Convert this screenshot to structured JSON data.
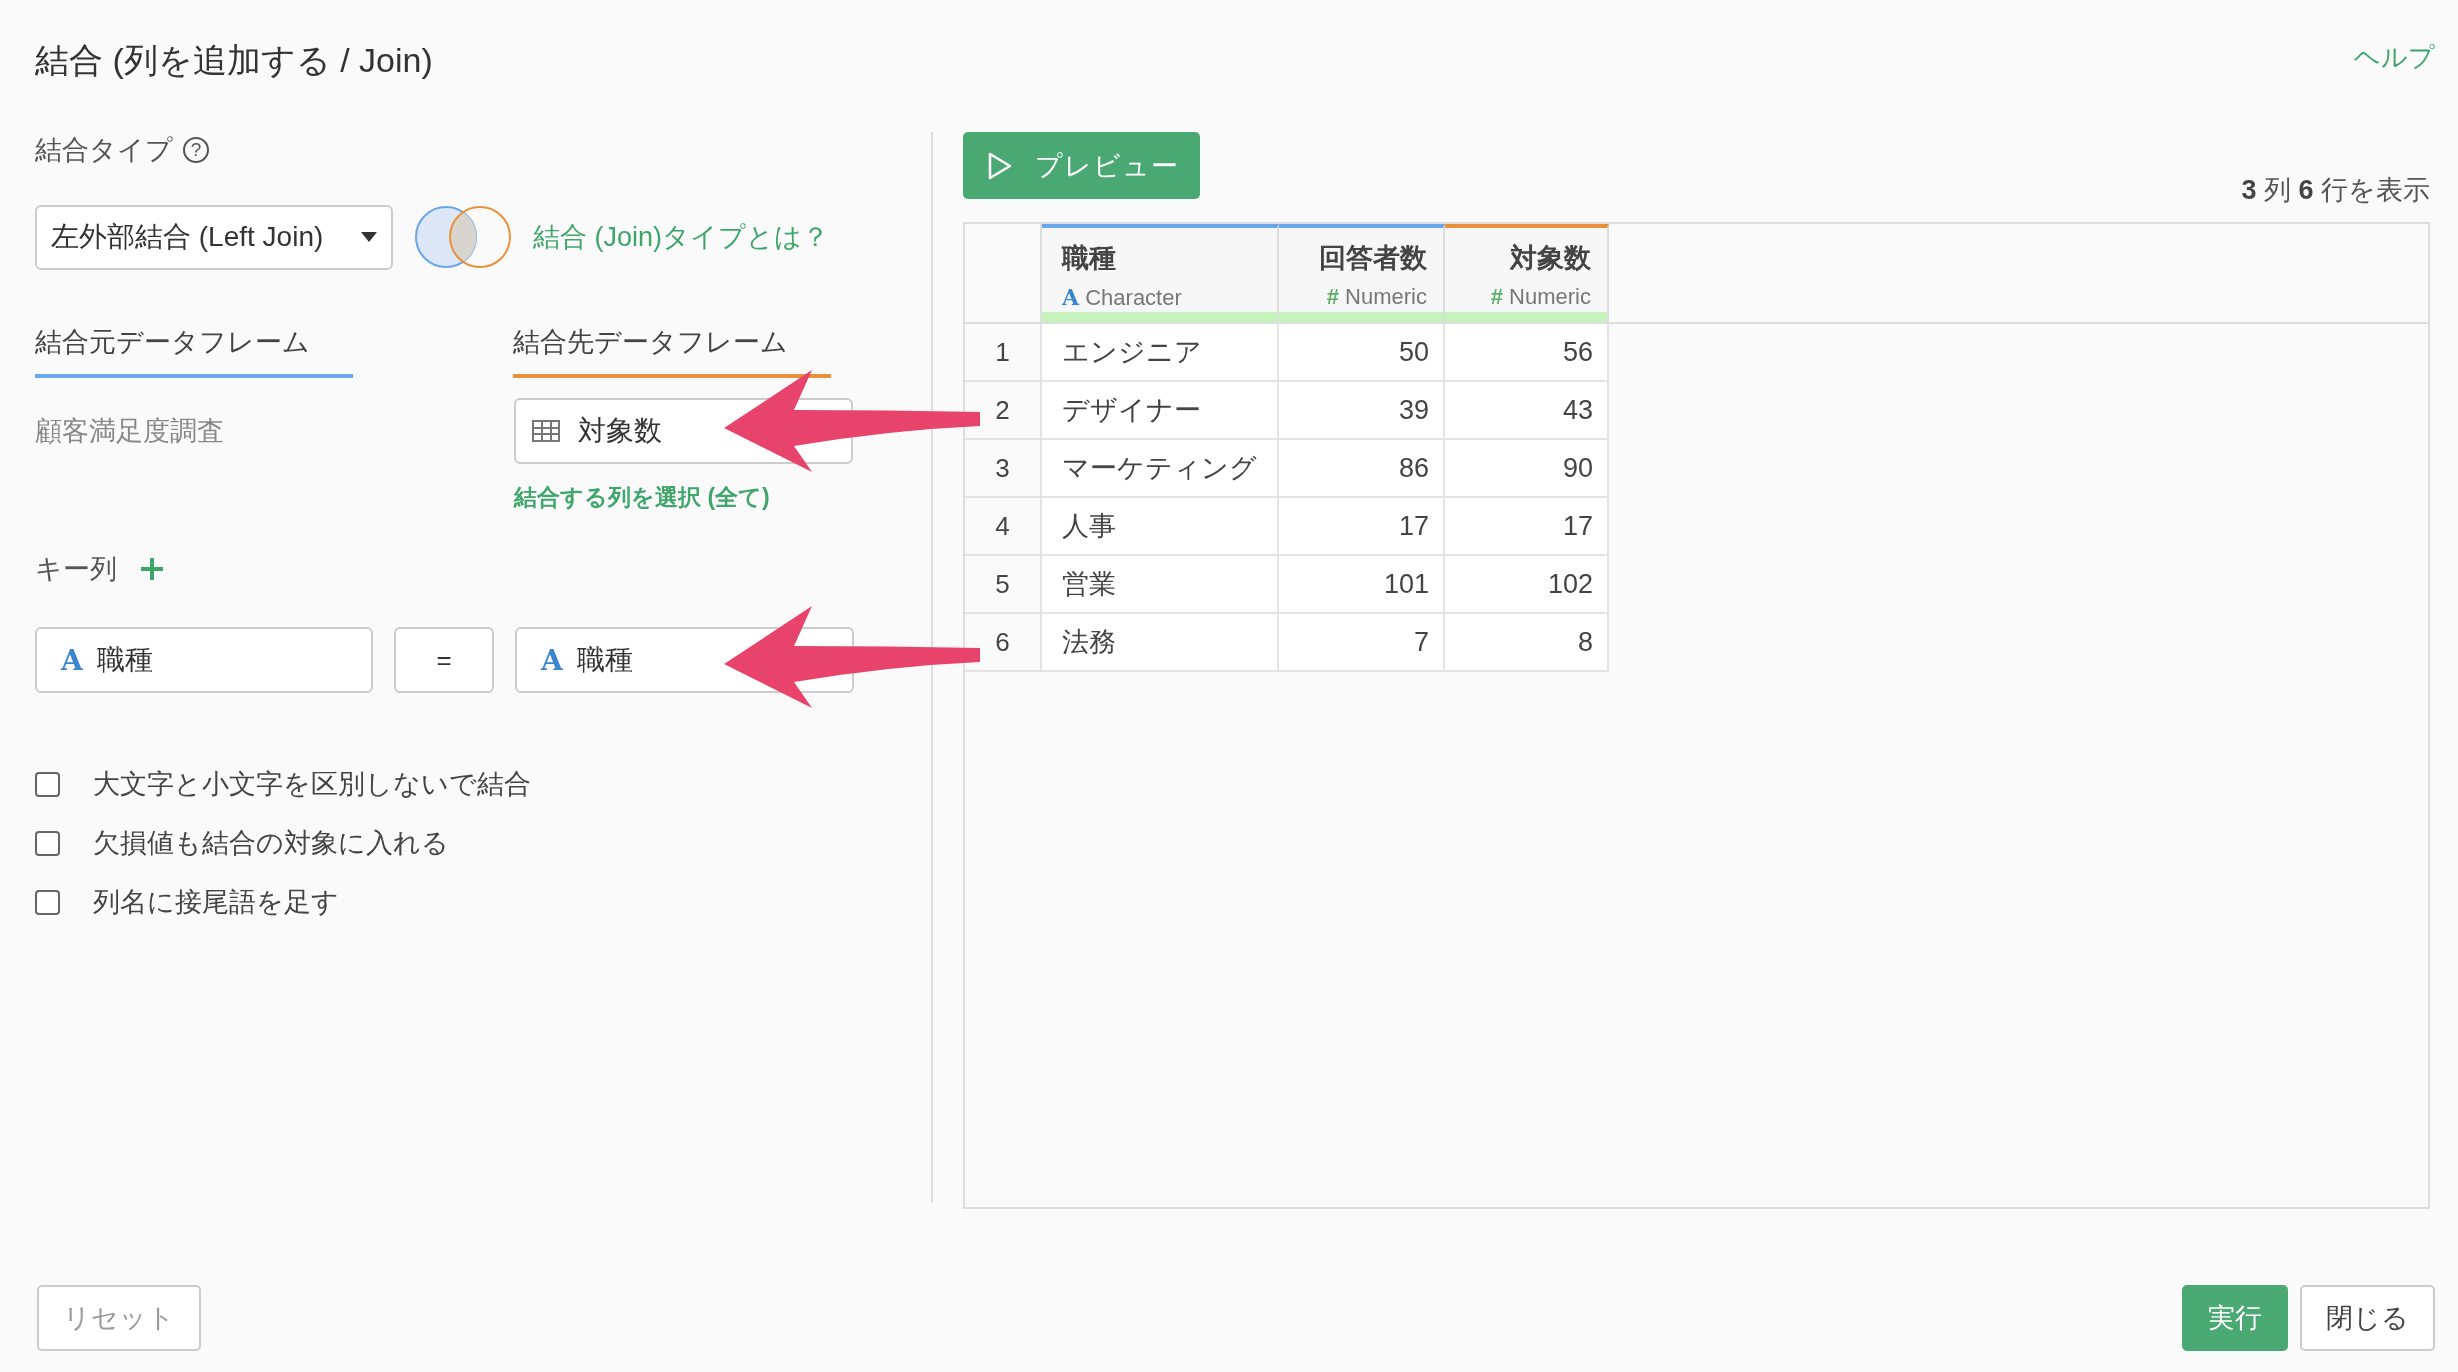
{
  "title": "結合 (列を追加する / Join)",
  "help_link": "ヘルプ",
  "join_type": {
    "label": "結合タイプ",
    "help_icon": "?",
    "select_value": "左外部結合 (Left Join)",
    "link": "結合 (Join)タイプとは？"
  },
  "tabs": [
    {
      "label": "結合元データフレーム",
      "color": "#6aa6ea"
    },
    {
      "label": "結合先データフレーム",
      "color": "#e8913a"
    }
  ],
  "source_name": "顧客満足度調査",
  "target": {
    "value": "対象数",
    "link": "結合する列を選択 (全て)"
  },
  "keys": {
    "label": "キー列",
    "rows": [
      {
        "left_icon": "A",
        "left": "職種",
        "operator": "=",
        "right_icon": "A",
        "right": "職種"
      }
    ]
  },
  "options": [
    {
      "label": "大文字と小文字を区別しないで結合",
      "checked": false
    },
    {
      "label": "欠損値も結合の対象に入れる",
      "checked": false
    },
    {
      "label": "列名に接尾語を足す",
      "checked": false
    }
  ],
  "preview_button": "プレビュー",
  "summary": "**3** 列  **6** 行を表示",
  "table": {
    "columns": [
      {
        "name": "職種",
        "kind": "character",
        "type_icon": "A",
        "type": "Character",
        "color": "#6aa6ea"
      },
      {
        "name": "回答者数",
        "kind": "numeric",
        "type_icon": "#",
        "type": "Numeric",
        "color": "#6aa6ea"
      },
      {
        "name": "対象数",
        "kind": "numeric",
        "type_icon": "#",
        "type": "Numeric",
        "color": "#e8913a"
      }
    ],
    "rows": [
      {
        "index": "1",
        "cells": [
          "エンジニア",
          "50",
          "56"
        ]
      },
      {
        "index": "2",
        "cells": [
          "デザイナー",
          "39",
          "43"
        ]
      },
      {
        "index": "3",
        "cells": [
          "マーケティング",
          "86",
          "90"
        ]
      },
      {
        "index": "4",
        "cells": [
          "人事",
          "17",
          "17"
        ]
      },
      {
        "index": "5",
        "cells": [
          "営業",
          "101",
          "102"
        ]
      },
      {
        "index": "6",
        "cells": [
          "法務",
          "7",
          "8"
        ]
      }
    ]
  },
  "buttons": {
    "reset": "リセット",
    "run": "実行",
    "close": "閉じる"
  }
}
